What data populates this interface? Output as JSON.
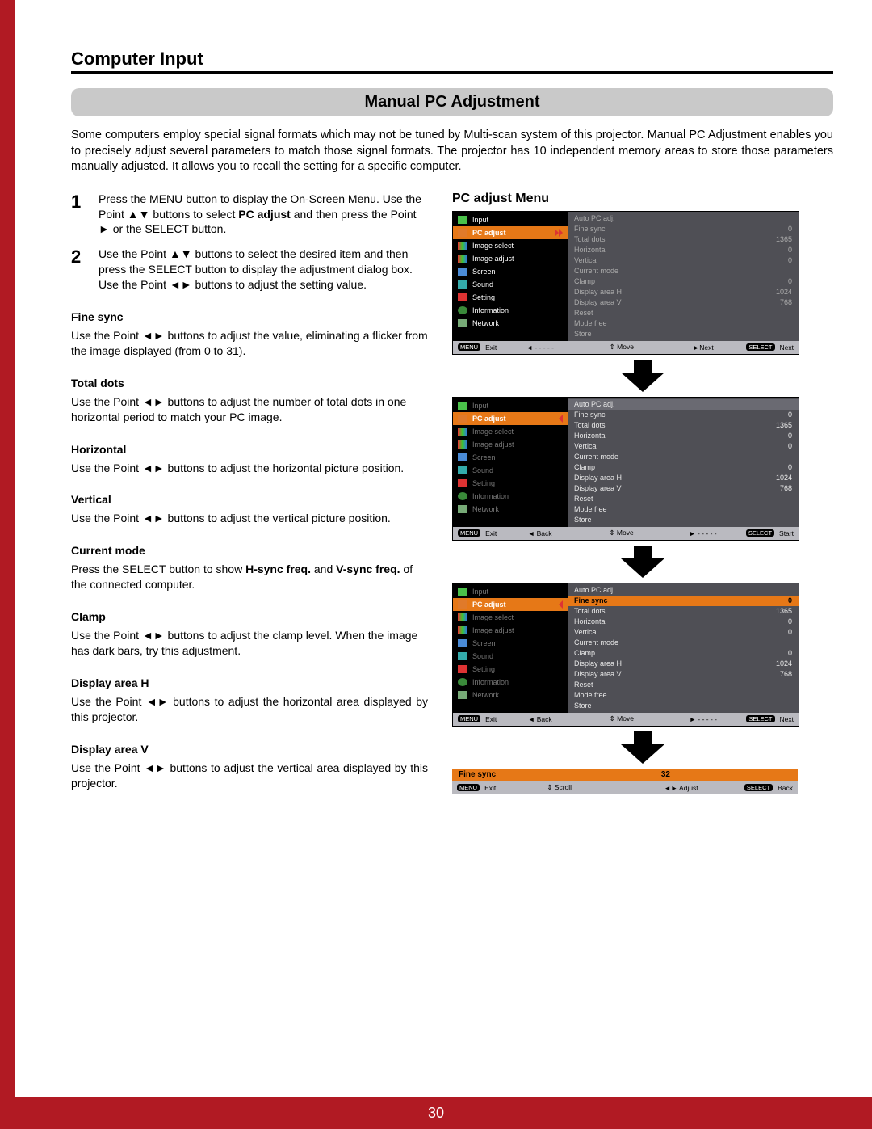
{
  "page_number": "30",
  "section_title": "Computer Input",
  "subheader": "Manual PC Adjustment",
  "intro": "Some computers employ special signal formats which may not be tuned by Multi-scan system of this projector. Manual PC Adjustment enables you to precisely adjust several parameters to match those signal formats. The projector has 10 independent memory areas to store those parameters manually adjusted. It allows you to recall the setting for a specific computer.",
  "steps": [
    {
      "num": "1",
      "text_pre": "Press the MENU button to display the On-Screen Menu. Use the Point ▲▼ buttons to select ",
      "bold": "PC adjust",
      "text_post": " and then press the Point ► or the SELECT button."
    },
    {
      "num": "2",
      "text_pre": "Use the Point ▲▼ buttons to select  the desired item and then press the SELECT button to display the adjustment dialog box. Use the Point ◄► buttons to adjust the setting value.",
      "bold": "",
      "text_post": ""
    }
  ],
  "params": [
    {
      "title": "Fine sync",
      "text": "Use the Point ◄► buttons to adjust the value, eliminating a flicker from the image displayed (from 0 to 31).",
      "justify": false
    },
    {
      "title": "Total dots",
      "text": "Use the Point ◄► buttons to adjust the number of total dots in one horizontal period to match your PC image.",
      "justify": false
    },
    {
      "title": "Horizontal",
      "text": "Use the Point ◄► buttons to adjust the horizontal picture position.",
      "justify": false
    },
    {
      "title": "Vertical",
      "text": "Use the Point ◄► buttons to adjust the vertical picture position.",
      "justify": false
    },
    {
      "title": "Current mode",
      "text_pre": "Press the SELECT button to show ",
      "b1": "H-sync freq.",
      "mid": " and ",
      "b2": "V-sync freq.",
      "text_post": " of the connected computer.",
      "justify": false
    },
    {
      "title": "Clamp",
      "text": "Use the Point ◄► buttons to adjust the clamp level. When the image has dark bars, try this adjustment.",
      "justify": false
    },
    {
      "title": "Display area H",
      "text": "Use the Point ◄► buttons to adjust the horizontal area displayed by this projector.",
      "justify": true
    },
    {
      "title": "Display area V",
      "text": "Use the Point ◄► buttons to adjust the vertical area displayed by this projector.",
      "justify": true
    }
  ],
  "right_title": "PC adjust Menu",
  "sidemenu": [
    {
      "icon": "ic-green",
      "label": "Input"
    },
    {
      "icon": "ic-orange",
      "label": "PC adjust"
    },
    {
      "icon": "ic-multi",
      "label": "Image select"
    },
    {
      "icon": "ic-multi",
      "label": "Image adjust"
    },
    {
      "icon": "ic-blue",
      "label": "Screen"
    },
    {
      "icon": "ic-teal",
      "label": "Sound"
    },
    {
      "icon": "ic-red",
      "label": "Setting"
    },
    {
      "icon": "ic-info",
      "label": "Information"
    },
    {
      "icon": "ic-net",
      "label": "Network"
    }
  ],
  "osd_items": [
    {
      "label": "Auto PC adj.",
      "val": ""
    },
    {
      "label": "Fine sync",
      "val": "0"
    },
    {
      "label": "Total dots",
      "val": "1365"
    },
    {
      "label": "Horizontal",
      "val": "0"
    },
    {
      "label": "Vertical",
      "val": "0"
    },
    {
      "label": "Current mode",
      "val": ""
    },
    {
      "label": "Clamp",
      "val": "0"
    },
    {
      "label": "Display area H",
      "val": "1024"
    },
    {
      "label": "Display area V",
      "val": "768"
    },
    {
      "label": "Reset",
      "val": ""
    },
    {
      "label": "Mode free",
      "val": ""
    },
    {
      "label": "Store",
      "val": ""
    }
  ],
  "foot": {
    "menu": "MENU",
    "exit": "Exit",
    "f1_a": "◄ - - - - -",
    "f1_b": "Move",
    "f1_c": "►Next",
    "f1_d": "SELECT",
    "f1_e": "Next",
    "f2_a": "◄ Back",
    "f2_b": "Move",
    "f2_c": "► - - - - -",
    "f2_d": "SELECT",
    "f2_e": "Start",
    "f3_a": "◄ Back",
    "f3_b": "Move",
    "f3_c": "► - - - - -",
    "f3_d": "SELECT",
    "f3_e": "Next",
    "f4_a": "Scroll",
    "f4_b": "◄► Adjust",
    "f4_c": "SELECT",
    "f4_d": "Back"
  },
  "updown": "⇕",
  "slider": {
    "label": "Fine sync",
    "value": "32"
  }
}
